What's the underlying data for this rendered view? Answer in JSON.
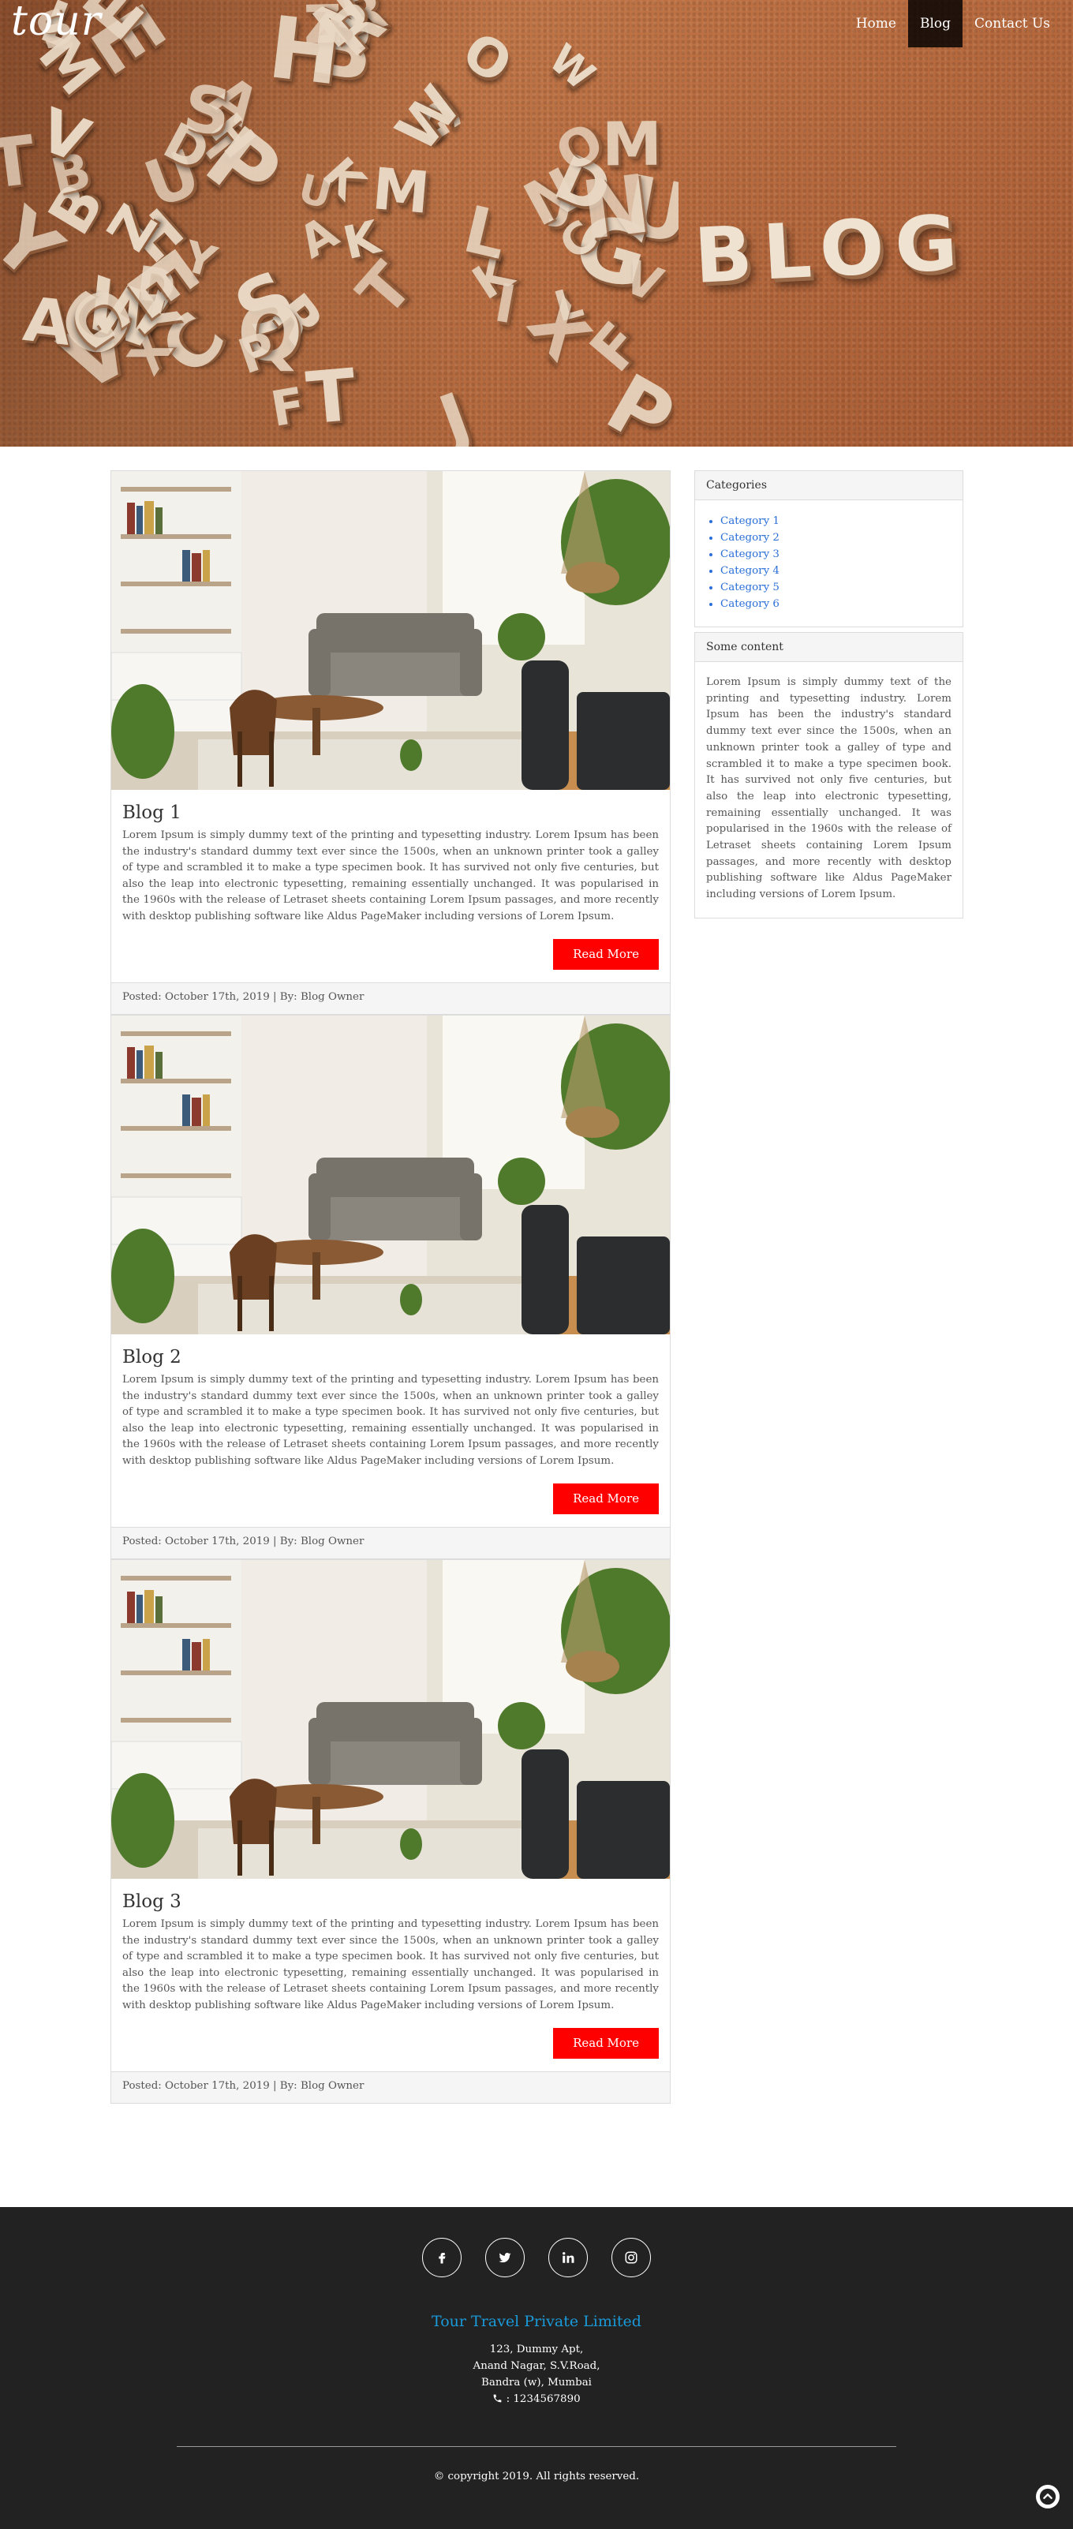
{
  "nav": {
    "logo": "tour",
    "links": [
      {
        "label": "Home",
        "active": false
      },
      {
        "label": "Blog",
        "active": true
      },
      {
        "label": "Contact Us",
        "active": false
      }
    ]
  },
  "hero": {
    "word": "BLOG"
  },
  "posts": [
    {
      "title": "Blog 1",
      "text": "Lorem Ipsum is simply dummy text of the printing and typesetting industry. Lorem Ipsum has been the industry's standard dummy text ever since the 1500s, when an unknown printer took a galley of type and scrambled it to make a type specimen book. It has survived not only five centuries, but also the leap into electronic typesetting, remaining essentially unchanged. It was popularised in the 1960s with the release of Letraset sheets containing Lorem Ipsum passages, and more recently with desktop publishing software like Aldus PageMaker including versions of Lorem Ipsum.",
      "button": "Read More",
      "footer": "Posted: October 17th, 2019 | By: Blog Owner"
    },
    {
      "title": "Blog 2",
      "text": "Lorem Ipsum is simply dummy text of the printing and typesetting industry. Lorem Ipsum has been the industry's standard dummy text ever since the 1500s, when an unknown printer took a galley of type and scrambled it to make a type specimen book. It has survived not only five centuries, but also the leap into electronic typesetting, remaining essentially unchanged. It was popularised in the 1960s with the release of Letraset sheets containing Lorem Ipsum passages, and more recently with desktop publishing software like Aldus PageMaker including versions of Lorem Ipsum.",
      "button": "Read More",
      "footer": "Posted: October 17th, 2019 | By: Blog Owner"
    },
    {
      "title": "Blog 3",
      "text": "Lorem Ipsum is simply dummy text of the printing and typesetting industry. Lorem Ipsum has been the industry's standard dummy text ever since the 1500s, when an unknown printer took a galley of type and scrambled it to make a type specimen book. It has survived not only five centuries, but also the leap into electronic typesetting, remaining essentially unchanged. It was popularised in the 1960s with the release of Letraset sheets containing Lorem Ipsum passages, and more recently with desktop publishing software like Aldus PageMaker including versions of Lorem Ipsum.",
      "button": "Read More",
      "footer": "Posted: October 17th, 2019 | By: Blog Owner"
    }
  ],
  "sidebar": {
    "categories_heading": "Categories",
    "categories": [
      "Category 1",
      "Category 2",
      "Category 3",
      "Category 4",
      "Category 5",
      "Category 6"
    ],
    "content_heading": "Some content",
    "content_text": "Lorem Ipsum is simply dummy text of the printing and typesetting industry. Lorem Ipsum has been the industry's standard dummy text ever since the 1500s, when an unknown printer took a galley of type and scrambled it to make a type specimen book. It has survived not only five centuries, but also the leap into electronic typesetting, remaining essentially unchanged. It was popularised in the 1960s with the release of Letraset sheets containing Lorem Ipsum passages, and more recently with desktop publishing software like Aldus PageMaker including versions of Lorem Ipsum."
  },
  "footer": {
    "social": [
      {
        "name": "facebook-icon",
        "glyph": "f"
      },
      {
        "name": "twitter-icon",
        "glyph": "t"
      },
      {
        "name": "linkedin-icon",
        "glyph": "in"
      },
      {
        "name": "instagram-icon",
        "glyph": "ig"
      }
    ],
    "company": "Tour Travel Private Limited",
    "address_lines": [
      "123, Dummy Apt,",
      "Anand Nagar, S.V.Road,",
      "Bandra (w), Mumbai"
    ],
    "phone": ": 1234567890",
    "copyright": "© copyright 2019. All rights reserved."
  },
  "colors": {
    "accent_red": "#ff0000",
    "link_blue": "#2a6fd8",
    "company_blue": "#1a9ad9",
    "footer_bg": "#222222"
  }
}
